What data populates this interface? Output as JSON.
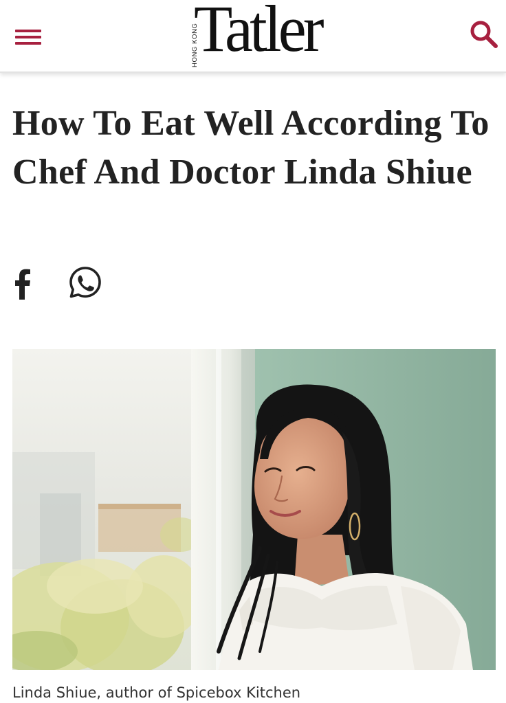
{
  "header": {
    "menu_icon": "hamburger-menu-icon",
    "logo_text": "Tatler",
    "logo_subtext": "HONG KONG",
    "search_icon": "search-icon",
    "accent_color": "#a7203f"
  },
  "article": {
    "title": "How To Eat Well According To Chef And Doctor Linda Shiue",
    "share": [
      {
        "icon": "facebook-icon"
      },
      {
        "icon": "whatsapp-icon"
      }
    ],
    "hero_image_alt": "Linda Shiue, author of Spicebox Kitchen",
    "caption": "Linda Shiue, author of Spicebox Kitchen"
  }
}
